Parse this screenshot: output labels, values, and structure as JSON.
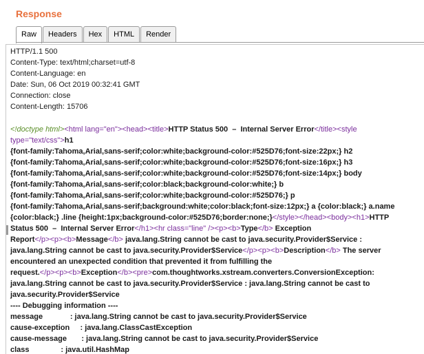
{
  "panel": {
    "title": "Response"
  },
  "tabs": [
    {
      "label": "Raw",
      "active": true
    },
    {
      "label": "Headers",
      "active": false
    },
    {
      "label": "Hex",
      "active": false
    },
    {
      "label": "HTML",
      "active": false
    },
    {
      "label": "Render",
      "active": false
    }
  ],
  "headers": [
    "HTTP/1.1 500",
    "Content-Type: text/html;charset=utf-8",
    "Content-Language: en",
    "Date: Sun, 06 Oct 2019 00:32:41 GMT",
    "Connection: close",
    "Content-Length: 15706"
  ],
  "body_lines": [
    [
      {
        "c": "dtype",
        "t": "<!doctype html>"
      },
      {
        "c": "tag",
        "t": "<html lang="
      },
      {
        "c": "val",
        "t": "\"en\""
      },
      {
        "c": "tag",
        "t": ">"
      },
      {
        "c": "tag",
        "t": "<head>"
      },
      {
        "c": "tag",
        "t": "<title>"
      },
      {
        "c": "txt",
        "t": "HTTP Status 500  –  Internal Server Error"
      },
      {
        "c": "tag",
        "t": "</title>"
      },
      {
        "c": "tag",
        "t": "<style"
      }
    ],
    [
      {
        "c": "tag",
        "t": "type="
      },
      {
        "c": "val",
        "t": "\"text/css\""
      },
      {
        "c": "tag",
        "t": ">"
      },
      {
        "c": "txt",
        "t": "h1"
      }
    ],
    [
      {
        "c": "txt",
        "t": "{font-family:Tahoma,Arial,sans-serif;color:white;background-color:#525D76;font-size:22px;} h2"
      }
    ],
    [
      {
        "c": "txt",
        "t": "{font-family:Tahoma,Arial,sans-serif;color:white;background-color:#525D76;font-size:16px;} h3"
      }
    ],
    [
      {
        "c": "txt",
        "t": "{font-family:Tahoma,Arial,sans-serif;color:white;background-color:#525D76;font-size:14px;} body"
      }
    ],
    [
      {
        "c": "txt",
        "t": "{font-family:Tahoma,Arial,sans-serif;color:black;background-color:white;} b"
      }
    ],
    [
      {
        "c": "txt",
        "t": "{font-family:Tahoma,Arial,sans-serif;color:white;background-color:#525D76;} p"
      }
    ],
    [
      {
        "c": "txt",
        "t": "{font-family:Tahoma,Arial,sans-serif;background:white;color:black;font-size:12px;} a {color:black;} a.name"
      }
    ],
    [
      {
        "c": "txt",
        "t": "{color:black;} .line {height:1px;background-color:#525D76;border:none;}"
      },
      {
        "c": "tag",
        "t": "</style>"
      },
      {
        "c": "tag",
        "t": "</head>"
      },
      {
        "c": "tag",
        "t": "<body>"
      },
      {
        "c": "tag",
        "t": "<h1>"
      },
      {
        "c": "txt",
        "t": "HTTP"
      }
    ],
    [
      {
        "c": "txt",
        "t": "Status 500  –  Internal Server Error"
      },
      {
        "c": "tag",
        "t": "</h1>"
      },
      {
        "c": "tag",
        "t": "<hr class="
      },
      {
        "c": "val",
        "t": "\"line\""
      },
      {
        "c": "tag",
        "t": " />"
      },
      {
        "c": "tag",
        "t": "<p>"
      },
      {
        "c": "tag",
        "t": "<b>"
      },
      {
        "c": "txt",
        "t": "Type"
      },
      {
        "c": "tag",
        "t": "</b>"
      },
      {
        "c": "txt",
        "t": " Exception"
      }
    ],
    [
      {
        "c": "txt",
        "t": "Report"
      },
      {
        "c": "tag",
        "t": "</p>"
      },
      {
        "c": "tag",
        "t": "<p>"
      },
      {
        "c": "tag",
        "t": "<b>"
      },
      {
        "c": "txt",
        "t": "Message"
      },
      {
        "c": "tag",
        "t": "</b>"
      },
      {
        "c": "txt",
        "t": " java.lang.String cannot be cast to java.security.Provider$Service :"
      }
    ],
    [
      {
        "c": "txt",
        "t": "java.lang.String cannot be cast to java.security.Provider$Service"
      },
      {
        "c": "tag",
        "t": "</p>"
      },
      {
        "c": "tag",
        "t": "<p>"
      },
      {
        "c": "tag",
        "t": "<b>"
      },
      {
        "c": "txt",
        "t": "Description"
      },
      {
        "c": "tag",
        "t": "</b>"
      },
      {
        "c": "txt",
        "t": " The server"
      }
    ],
    [
      {
        "c": "txt",
        "t": "encountered an unexpected condition that prevented it from fulfilling the"
      }
    ],
    [
      {
        "c": "txt",
        "t": "request."
      },
      {
        "c": "tag",
        "t": "</p>"
      },
      {
        "c": "tag",
        "t": "<p>"
      },
      {
        "c": "tag",
        "t": "<b>"
      },
      {
        "c": "txt",
        "t": "Exception"
      },
      {
        "c": "tag",
        "t": "</b>"
      },
      {
        "c": "tag",
        "t": "<pre>"
      },
      {
        "c": "txt",
        "t": "com.thoughtworks.xstream.converters.ConversionException:"
      }
    ],
    [
      {
        "c": "txt",
        "t": "java.lang.String cannot be cast to java.security.Provider$Service : java.lang.String cannot be cast to"
      }
    ],
    [
      {
        "c": "txt",
        "t": "java.security.Provider$Service"
      }
    ],
    [
      {
        "c": "txt",
        "t": "---- Debugging information ----"
      }
    ],
    [
      {
        "c": "txt",
        "t": "message             : java.lang.String cannot be cast to java.security.Provider$Service"
      }
    ],
    [
      {
        "c": "txt",
        "t": "cause-exception     : java.lang.ClassCastException"
      }
    ],
    [
      {
        "c": "txt",
        "t": "cause-message       : java.lang.String cannot be cast to java.security.Provider$Service"
      }
    ],
    [
      {
        "c": "txt",
        "t": "class               : java.util.HashMap"
      }
    ]
  ]
}
